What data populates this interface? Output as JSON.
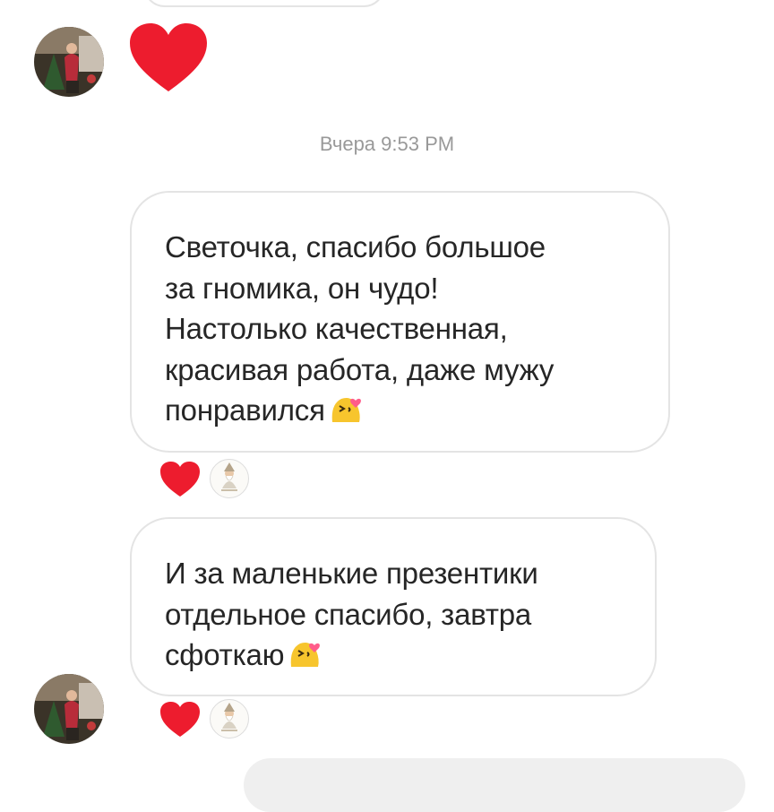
{
  "timestamp": "Вчера 9:53 PM",
  "messages": [
    {
      "text": "Светочка, спасибо большое\nза гномика, он чудо!\nНастолько качественная,\nкрасивая работа, даже мужу\nпонравился",
      "emoji": "kissing-heart-emoji",
      "reactions": [
        "heart",
        "user-avatar"
      ]
    },
    {
      "text": "И за маленькие презентики\nотдельное спасибо, завтра\nсфоткаю",
      "emoji": "kissing-heart-emoji",
      "reactions": [
        "heart",
        "user-avatar"
      ]
    }
  ],
  "colors": {
    "heart": "#ed1c2e",
    "bubble_border": "#e4e4e4",
    "timestamp": "#999999",
    "text": "#262626",
    "emoji_face": "#f7c52d",
    "emoji_heart": "#ff5c8a"
  }
}
